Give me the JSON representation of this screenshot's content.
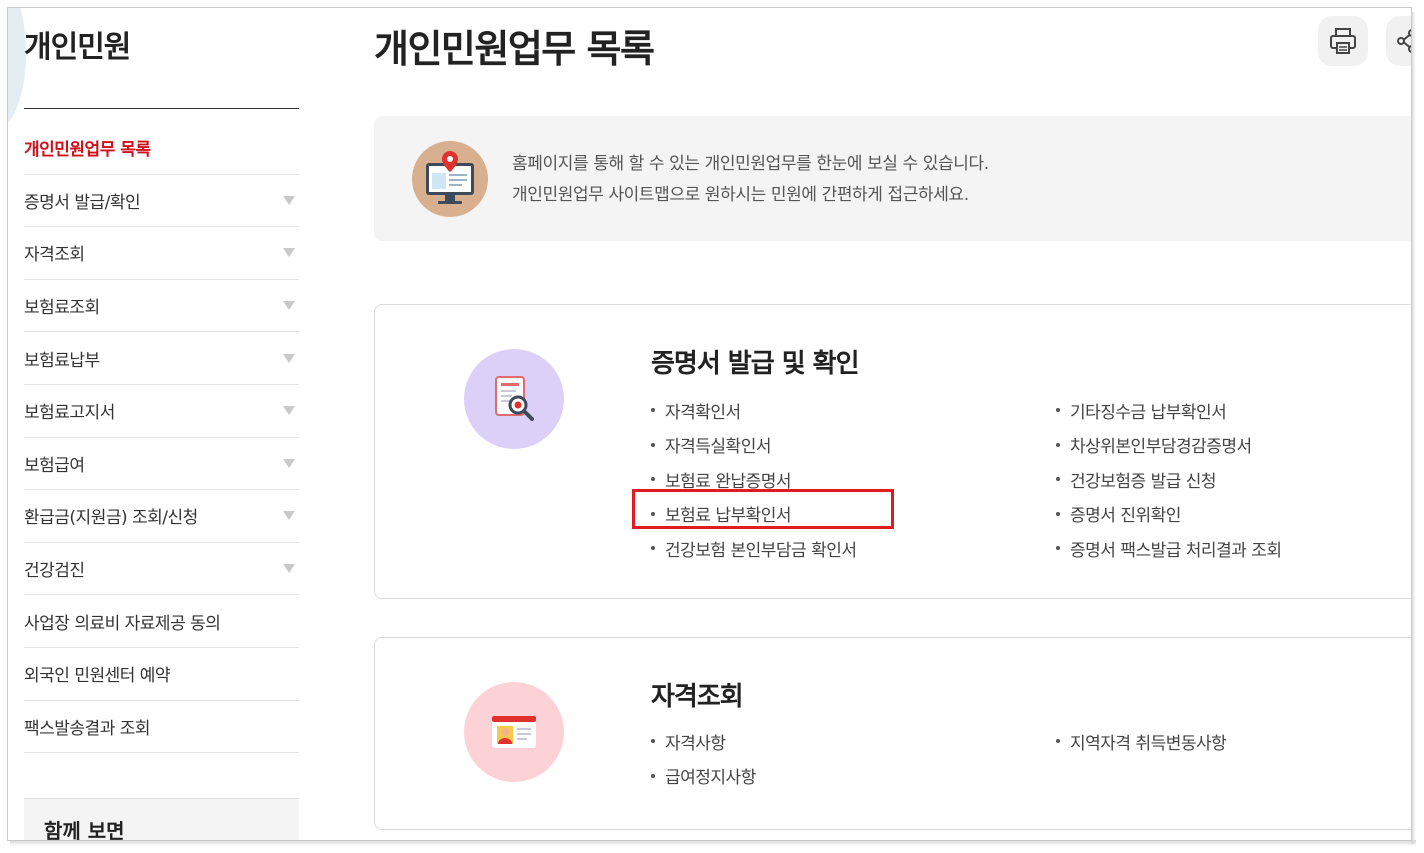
{
  "sidebar": {
    "title": "개인민원",
    "items": [
      {
        "label": "개인민원업무 목록",
        "active": true,
        "expandable": false
      },
      {
        "label": "증명서 발급/확인",
        "active": false,
        "expandable": true
      },
      {
        "label": "자격조회",
        "active": false,
        "expandable": true
      },
      {
        "label": "보험료조회",
        "active": false,
        "expandable": true
      },
      {
        "label": "보험료납부",
        "active": false,
        "expandable": true
      },
      {
        "label": "보험료고지서",
        "active": false,
        "expandable": true
      },
      {
        "label": "보험급여",
        "active": false,
        "expandable": true
      },
      {
        "label": "환급금(지원금) 조회/신청",
        "active": false,
        "expandable": true
      },
      {
        "label": "건강검진",
        "active": false,
        "expandable": true
      },
      {
        "label": "사업장 의료비 자료제공 동의",
        "active": false,
        "expandable": false
      },
      {
        "label": "외국인 민원센터 예약",
        "active": false,
        "expandable": false
      },
      {
        "label": "팩스발송결과 조회",
        "active": false,
        "expandable": false
      }
    ],
    "related_title": "함께 보면"
  },
  "main": {
    "title": "개인민원업무 목록",
    "intro": {
      "line1": "홈페이지를 통해 할 수 있는 개인민원업무를 한눈에 보실 수 있습니다.",
      "line2": "개인민원업무 사이트맵으로 원하시는 민원에 간편하게 접근하세요."
    },
    "sections": [
      {
        "title": "증명서 발급 및 확인",
        "icon": "document-search-icon",
        "col1": [
          "자격확인서",
          "자격득실확인서",
          "보험료 완납증명서",
          "보험료 납부확인서",
          "건강보험 본인부담금 확인서"
        ],
        "col2": [
          "기타징수금 납부확인서",
          "차상위본인부담경감증명서",
          "건강보험증 발급 신청",
          "증명서 진위확인",
          "증명서 팩스발급 처리결과 조회"
        ]
      },
      {
        "title": "자격조회",
        "icon": "id-card-icon",
        "col1": [
          "자격사항",
          "급여정지사항"
        ],
        "col2": [
          "지역자격 취득변동사항"
        ]
      }
    ]
  },
  "toolbar": {
    "print_icon": "print-icon",
    "share_icon": "share-icon"
  },
  "colors": {
    "active": "#d0111b",
    "highlight": "#e21a22",
    "intro_bg": "#f4f4f4",
    "icon1_bg": "#ddd0f8",
    "icon2_bg": "#fdd2d6"
  }
}
